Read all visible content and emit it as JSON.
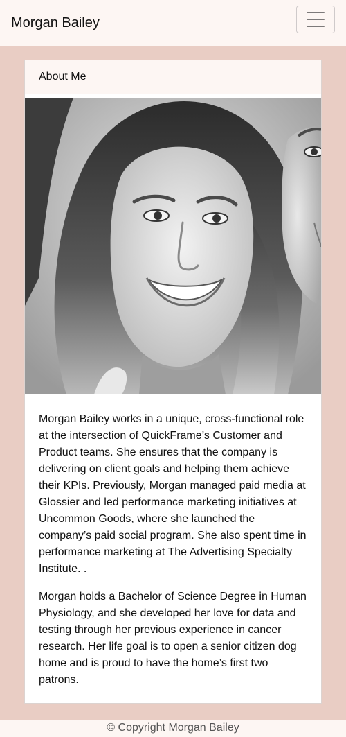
{
  "navbar": {
    "brand": "Morgan Bailey",
    "toggle_icon": "hamburger-menu-icon"
  },
  "card": {
    "header": "About Me",
    "photo_subject": "black-and-white portrait photo",
    "paragraphs": [
      "Morgan Bailey works in a unique, cross-functional role at the intersection of QuickFrame’s Customer and Product teams. She ensures that the company is delivering on client goals and helping them achieve their KPIs. Previously, Morgan managed paid media at Glossier and led performance marketing initiatives at Uncommon Goods, where she launched the company’s paid social program. She also spent time in performance marketing at The Advertising Specialty Institute. .",
      "Morgan holds a Bachelor of Science Degree in Human Physiology, and she developed her love for data and testing through her previous experience in cancer research. Her life goal is to open a senior citizen dog home and is proud to have the home’s first two patrons."
    ]
  },
  "footer": {
    "copyright": "© Copyright Morgan Bailey"
  },
  "colors": {
    "page_background": "#e9cdc4",
    "navbar_background": "#fdf6f3",
    "card_background": "#ffffff"
  }
}
